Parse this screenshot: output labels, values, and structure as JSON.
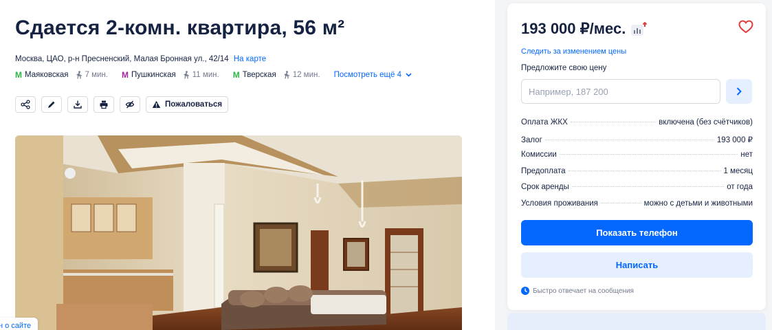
{
  "listing": {
    "title": "Сдается 2-комн. квартира, 56 м²",
    "address": "Москва, ЦАО, р-н Пресненский, Малая Бронная ул., 42/14",
    "map_link": "На карте",
    "metro": [
      {
        "icon": "M",
        "name": "Маяковская",
        "walk": "7 мин."
      },
      {
        "icon": "M",
        "name": "Пушкинская",
        "walk": "11 мин."
      },
      {
        "icon": "M",
        "name": "Тверская",
        "walk": "12 мин."
      }
    ],
    "more_link": "Посмотреть ещё 4",
    "report_label": "Пожаловаться",
    "badge_text": "н о сайте"
  },
  "colors": {
    "accent": "#0468ff",
    "metro_1": "#2db844",
    "metro_2": "#9e2a9b",
    "metro_3": "#2db844",
    "favorite": "#e23e3e"
  },
  "icons": [
    "share-icon",
    "edit-icon",
    "download-icon",
    "print-icon",
    "hide-icon",
    "warning-icon",
    "heart-icon",
    "chart-icon",
    "chevron-right-icon",
    "chevron-down-icon",
    "walk-icon",
    "clock-icon"
  ],
  "sidebar": {
    "price": "193 000 ₽/мес.",
    "watch_price": "Следить за изменением цены",
    "offer_label": "Предложите свою цену",
    "offer_placeholder": "Например, 187 200",
    "terms": [
      {
        "label": "Оплата ЖКХ",
        "value": "включена (без счётчиков)"
      },
      {
        "label": "Залог",
        "value": "193 000 ₽"
      },
      {
        "label": "Комиссии",
        "value": "нет"
      },
      {
        "label": "Предоплата",
        "value": "1 месяц"
      },
      {
        "label": "Срок аренды",
        "value": "от года"
      },
      {
        "label": "Условия проживания",
        "value": "можно с детьми и животными"
      }
    ],
    "phone_button": "Показать телефон",
    "write_button": "Написать",
    "fast_reply": "Быстро отвечает на сообщения"
  }
}
